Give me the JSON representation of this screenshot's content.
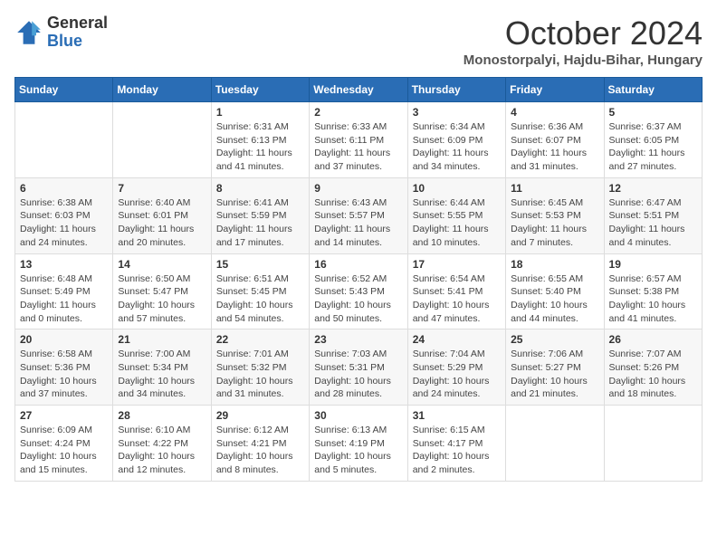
{
  "logo": {
    "general": "General",
    "blue": "Blue"
  },
  "title": "October 2024",
  "subtitle": "Monostorpalyi, Hajdu-Bihar, Hungary",
  "days_of_week": [
    "Sunday",
    "Monday",
    "Tuesday",
    "Wednesday",
    "Thursday",
    "Friday",
    "Saturday"
  ],
  "weeks": [
    [
      {
        "day": "",
        "info": ""
      },
      {
        "day": "",
        "info": ""
      },
      {
        "day": "1",
        "info": "Sunrise: 6:31 AM\nSunset: 6:13 PM\nDaylight: 11 hours and 41 minutes."
      },
      {
        "day": "2",
        "info": "Sunrise: 6:33 AM\nSunset: 6:11 PM\nDaylight: 11 hours and 37 minutes."
      },
      {
        "day": "3",
        "info": "Sunrise: 6:34 AM\nSunset: 6:09 PM\nDaylight: 11 hours and 34 minutes."
      },
      {
        "day": "4",
        "info": "Sunrise: 6:36 AM\nSunset: 6:07 PM\nDaylight: 11 hours and 31 minutes."
      },
      {
        "day": "5",
        "info": "Sunrise: 6:37 AM\nSunset: 6:05 PM\nDaylight: 11 hours and 27 minutes."
      }
    ],
    [
      {
        "day": "6",
        "info": "Sunrise: 6:38 AM\nSunset: 6:03 PM\nDaylight: 11 hours and 24 minutes."
      },
      {
        "day": "7",
        "info": "Sunrise: 6:40 AM\nSunset: 6:01 PM\nDaylight: 11 hours and 20 minutes."
      },
      {
        "day": "8",
        "info": "Sunrise: 6:41 AM\nSunset: 5:59 PM\nDaylight: 11 hours and 17 minutes."
      },
      {
        "day": "9",
        "info": "Sunrise: 6:43 AM\nSunset: 5:57 PM\nDaylight: 11 hours and 14 minutes."
      },
      {
        "day": "10",
        "info": "Sunrise: 6:44 AM\nSunset: 5:55 PM\nDaylight: 11 hours and 10 minutes."
      },
      {
        "day": "11",
        "info": "Sunrise: 6:45 AM\nSunset: 5:53 PM\nDaylight: 11 hours and 7 minutes."
      },
      {
        "day": "12",
        "info": "Sunrise: 6:47 AM\nSunset: 5:51 PM\nDaylight: 11 hours and 4 minutes."
      }
    ],
    [
      {
        "day": "13",
        "info": "Sunrise: 6:48 AM\nSunset: 5:49 PM\nDaylight: 11 hours and 0 minutes."
      },
      {
        "day": "14",
        "info": "Sunrise: 6:50 AM\nSunset: 5:47 PM\nDaylight: 10 hours and 57 minutes."
      },
      {
        "day": "15",
        "info": "Sunrise: 6:51 AM\nSunset: 5:45 PM\nDaylight: 10 hours and 54 minutes."
      },
      {
        "day": "16",
        "info": "Sunrise: 6:52 AM\nSunset: 5:43 PM\nDaylight: 10 hours and 50 minutes."
      },
      {
        "day": "17",
        "info": "Sunrise: 6:54 AM\nSunset: 5:41 PM\nDaylight: 10 hours and 47 minutes."
      },
      {
        "day": "18",
        "info": "Sunrise: 6:55 AM\nSunset: 5:40 PM\nDaylight: 10 hours and 44 minutes."
      },
      {
        "day": "19",
        "info": "Sunrise: 6:57 AM\nSunset: 5:38 PM\nDaylight: 10 hours and 41 minutes."
      }
    ],
    [
      {
        "day": "20",
        "info": "Sunrise: 6:58 AM\nSunset: 5:36 PM\nDaylight: 10 hours and 37 minutes."
      },
      {
        "day": "21",
        "info": "Sunrise: 7:00 AM\nSunset: 5:34 PM\nDaylight: 10 hours and 34 minutes."
      },
      {
        "day": "22",
        "info": "Sunrise: 7:01 AM\nSunset: 5:32 PM\nDaylight: 10 hours and 31 minutes."
      },
      {
        "day": "23",
        "info": "Sunrise: 7:03 AM\nSunset: 5:31 PM\nDaylight: 10 hours and 28 minutes."
      },
      {
        "day": "24",
        "info": "Sunrise: 7:04 AM\nSunset: 5:29 PM\nDaylight: 10 hours and 24 minutes."
      },
      {
        "day": "25",
        "info": "Sunrise: 7:06 AM\nSunset: 5:27 PM\nDaylight: 10 hours and 21 minutes."
      },
      {
        "day": "26",
        "info": "Sunrise: 7:07 AM\nSunset: 5:26 PM\nDaylight: 10 hours and 18 minutes."
      }
    ],
    [
      {
        "day": "27",
        "info": "Sunrise: 6:09 AM\nSunset: 4:24 PM\nDaylight: 10 hours and 15 minutes."
      },
      {
        "day": "28",
        "info": "Sunrise: 6:10 AM\nSunset: 4:22 PM\nDaylight: 10 hours and 12 minutes."
      },
      {
        "day": "29",
        "info": "Sunrise: 6:12 AM\nSunset: 4:21 PM\nDaylight: 10 hours and 8 minutes."
      },
      {
        "day": "30",
        "info": "Sunrise: 6:13 AM\nSunset: 4:19 PM\nDaylight: 10 hours and 5 minutes."
      },
      {
        "day": "31",
        "info": "Sunrise: 6:15 AM\nSunset: 4:17 PM\nDaylight: 10 hours and 2 minutes."
      },
      {
        "day": "",
        "info": ""
      },
      {
        "day": "",
        "info": ""
      }
    ]
  ]
}
